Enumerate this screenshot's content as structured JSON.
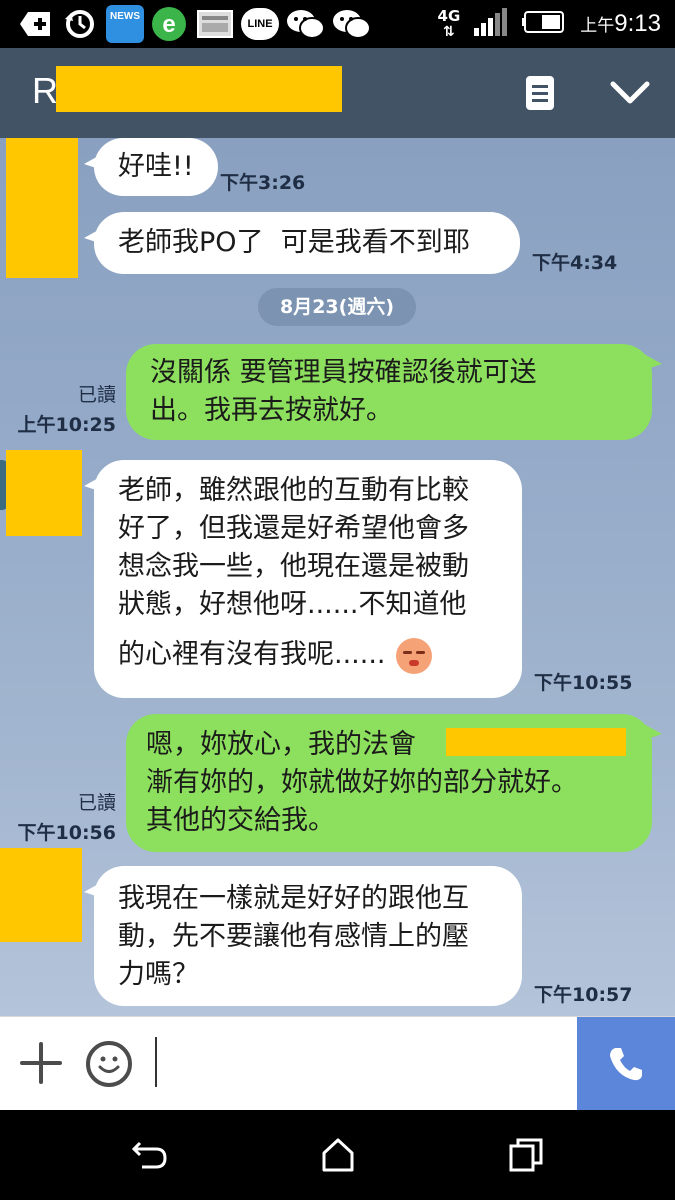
{
  "status_bar": {
    "icons": [
      "add-icon",
      "sync-icon",
      "news-app-icon",
      "browser-icon",
      "screenshot-icon",
      "line-app-icon",
      "wechat-icon",
      "wechat-icon"
    ],
    "news_label": "NEWS",
    "line_label": "LINE",
    "network": "4G",
    "time_prefix": "上午",
    "time": "9:13"
  },
  "header": {
    "title": "R",
    "icons": [
      "note-icon",
      "chevron-down-icon"
    ]
  },
  "messages": [
    {
      "side": "in",
      "text": "好哇!!",
      "time": "下午3:26"
    },
    {
      "side": "in",
      "text": "老師我PO了  可是我看不到耶",
      "time": "下午4:34"
    },
    {
      "side": "date",
      "text": "8月23(週六)"
    },
    {
      "side": "out",
      "text": "沒關係 要管理員按確認後就可送\n出。我再去按就好。",
      "read": "已讀",
      "time": "上午10:25"
    },
    {
      "side": "in",
      "text": "老師，雖然跟他的互動有比較\n好了，但我還是好希望他會多\n想念我一些，他現在還是被動\n狀態，好想他呀......不知道他",
      "text_last": "的心裡有沒有我呢......",
      "time": "下午10:55"
    },
    {
      "side": "out",
      "text": "嗯，妳放心，我的法會\n漸有妳的，妳就做好妳的部分就好。\n其他的交給我。",
      "read": "已讀",
      "time": "下午10:56"
    },
    {
      "side": "in",
      "text": "我現在一樣就是好好的跟他互\n動，先不要讓他有感情上的壓\n力嗎？",
      "time": "下午10:57"
    }
  ],
  "input_bar": {
    "icons": [
      "plus-icon",
      "emoji-icon",
      "phone-call-icon"
    ]
  },
  "nav_bar": {
    "icons": [
      "back-icon",
      "home-icon",
      "recents-icon"
    ]
  },
  "colors": {
    "header_bg": "#415364",
    "outgoing_bubble": "#8de05d",
    "incoming_bubble": "#ffffff",
    "call_button": "#5b86d9",
    "redaction": "#ffc700"
  }
}
